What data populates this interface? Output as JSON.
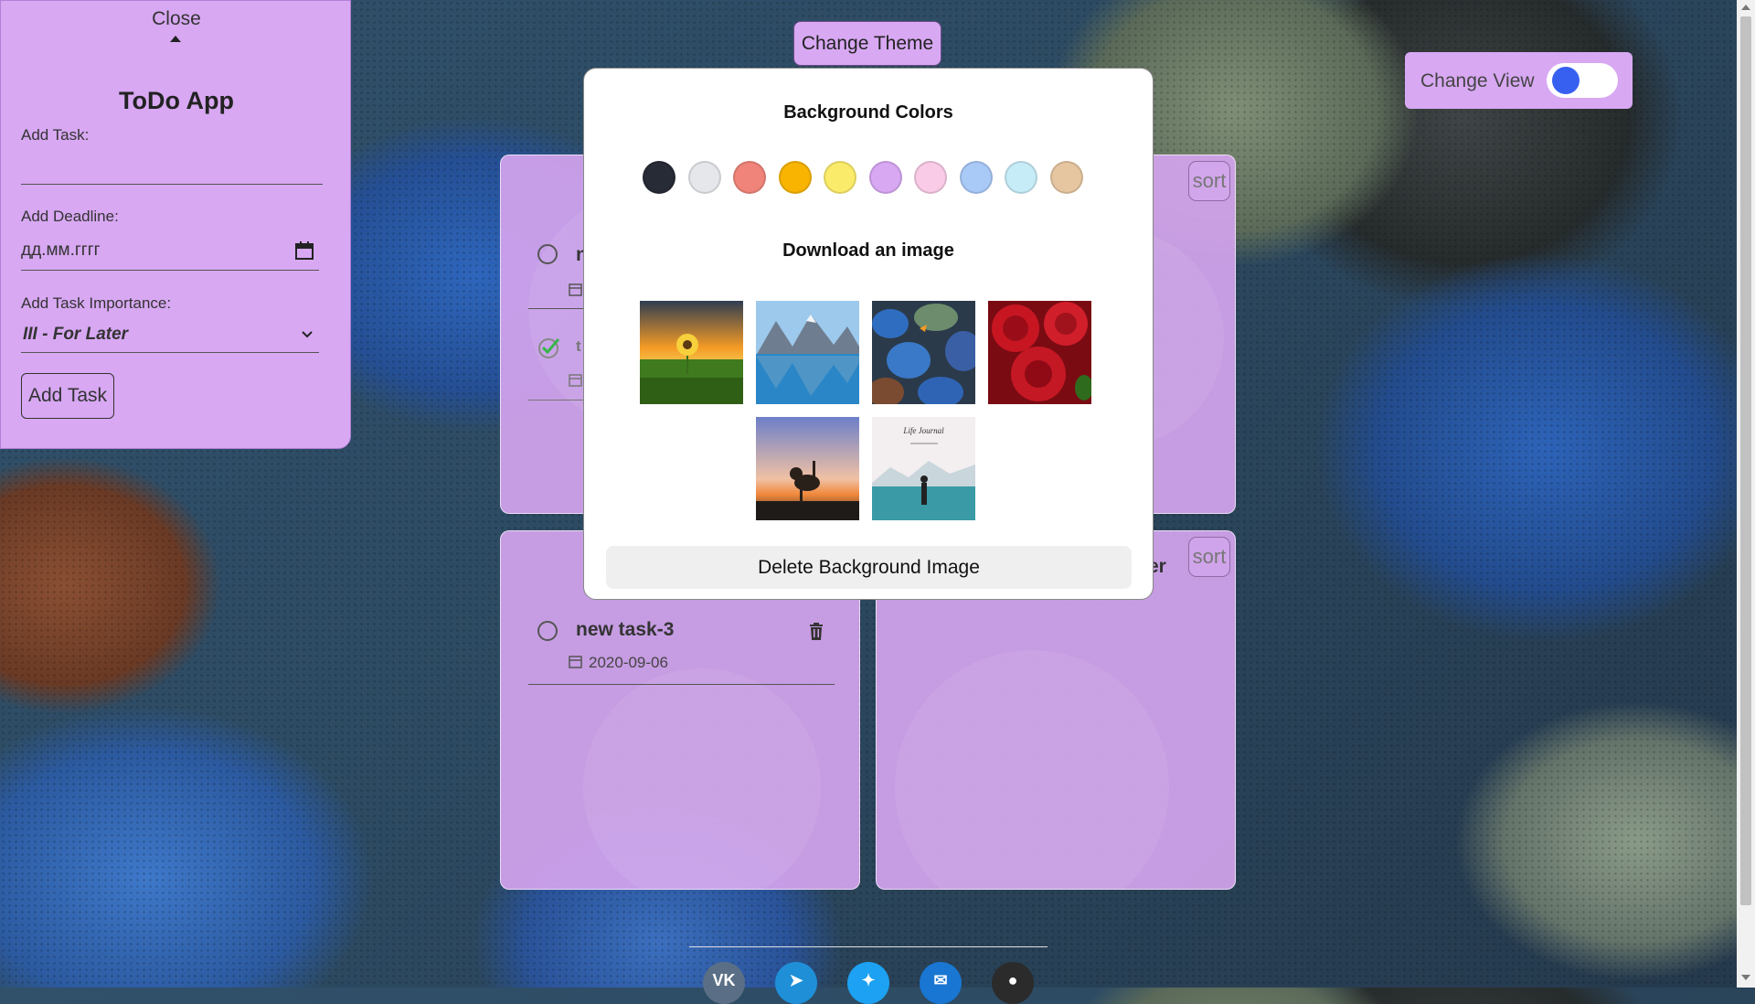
{
  "sidebar": {
    "close_label": "Close",
    "title": "ToDo App",
    "add_task_label": "Add Task:",
    "add_task_value": "",
    "deadline_label": "Add Deadline:",
    "deadline_placeholder": "дд.мм.гггг",
    "importance_label": "Add Task Importance:",
    "importance_value": "III - For Later",
    "add_button": "Add Task"
  },
  "header": {
    "theme_button": "Change Theme",
    "view_label": "Change View",
    "view_toggle_on": true
  },
  "cards": [
    {
      "sort_label": "sort",
      "tasks": [
        {
          "title": "n",
          "completed": false
        },
        {
          "title": "t",
          "completed": true
        }
      ]
    },
    {
      "sort_label": "sort",
      "tasks": [
        {
          "title": "new task-3",
          "date": "2020-09-06",
          "completed": false
        }
      ],
      "peek_text": "er"
    }
  ],
  "modal": {
    "colors_heading": "Background Colors",
    "colors": [
      "#272b36",
      "#e5e7eb",
      "#f0847a",
      "#f8b400",
      "#fbeb6a",
      "#d8a8f3",
      "#f9cbe6",
      "#a9c9f7",
      "#c6ecf7",
      "#e6c6a1"
    ],
    "images_heading": "Download an image",
    "images": [
      "sunflower-sunset",
      "mountain-lake",
      "blue-pebbles",
      "red-roses",
      "dancing-cat-sunset",
      "life-journal-lake"
    ],
    "image_caption": "Life Journal",
    "delete_button": "Delete Background Image"
  },
  "footer": {
    "social": [
      {
        "name": "vk",
        "glyph": "VK",
        "color": "#5a6f86"
      },
      {
        "name": "telegram",
        "glyph": "➤",
        "color": "#1f90d8"
      },
      {
        "name": "twitter",
        "glyph": "✦",
        "color": "#1da1f2"
      },
      {
        "name": "email",
        "glyph": "✉",
        "color": "#1976d2"
      },
      {
        "name": "github",
        "glyph": "●",
        "color": "#2b2b2b"
      }
    ]
  }
}
